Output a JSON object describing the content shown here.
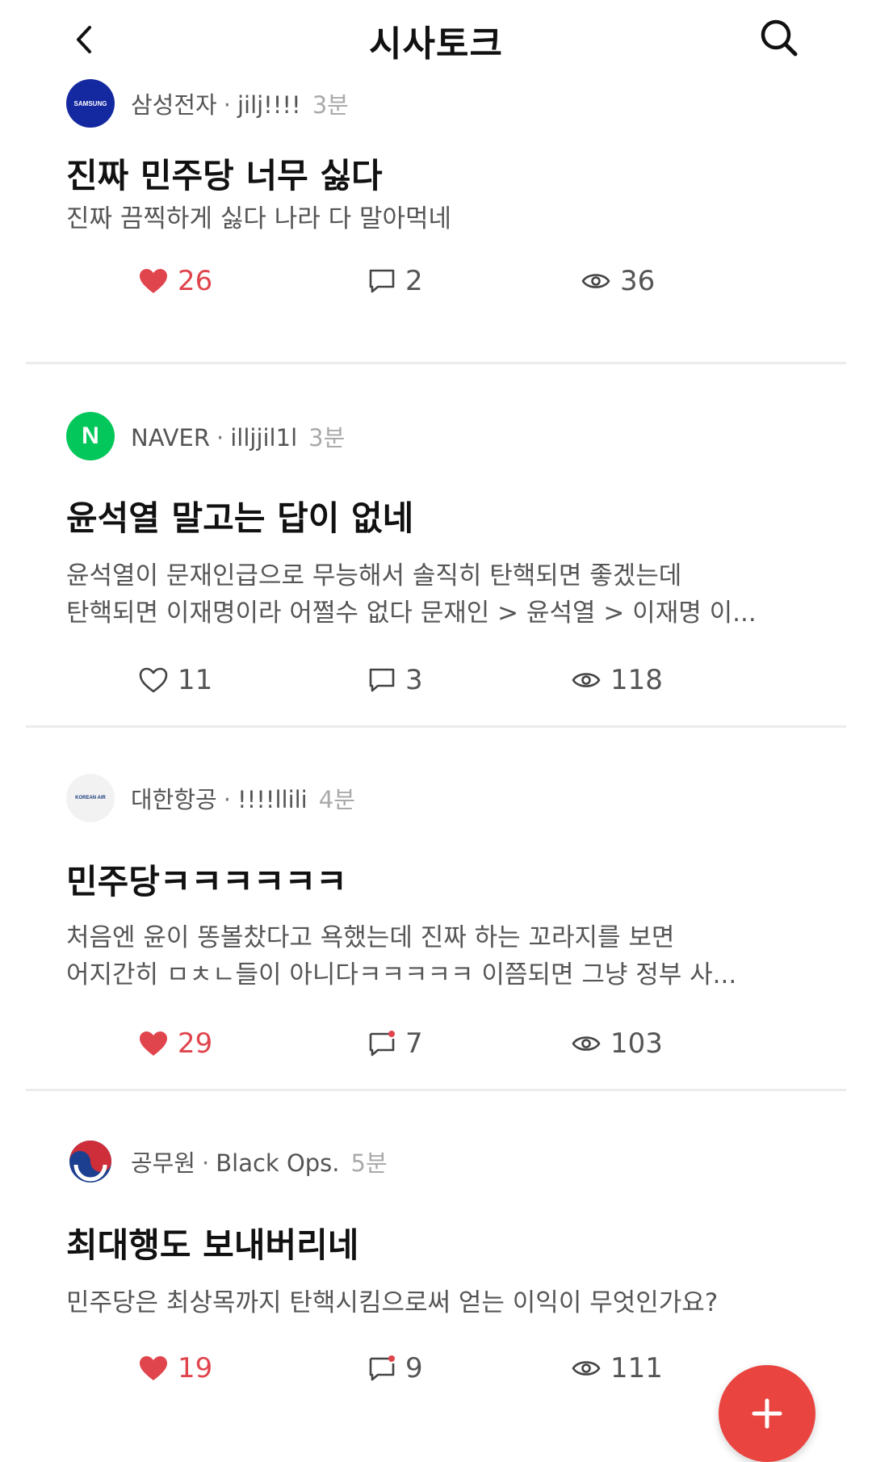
{
  "header": {
    "title": "시사토크",
    "back_icon": "chevron-left-icon",
    "search_icon": "search-icon"
  },
  "posts": [
    {
      "company": "삼성전자",
      "author": "jilj!!!!",
      "time": "3분",
      "logo_icon": "samsung-logo",
      "logo_text": "SAMSUNG",
      "title": "진짜 민주당 너무 싫다",
      "body": [
        "진짜 끔찍하게 싫다 나라 다 말아먹네"
      ],
      "likes": "26",
      "liked": true,
      "comments": "2",
      "views": "36"
    },
    {
      "company": "NAVER",
      "author": "illjjil1l",
      "time": "3분",
      "logo_icon": "naver-logo",
      "logo_text": "N",
      "title": "윤석열 말고는 답이 없네",
      "body": [
        "윤석열이 문재인급으로 무능해서 솔직히 탄핵되면 좋겠는데",
        "탄핵되면 이재명이라 어쩔수 없다  문재인 > 윤석열 > 이재명 이..."
      ],
      "likes": "11",
      "liked": false,
      "comments": "3",
      "views": "118"
    },
    {
      "company": "대한항공",
      "author": "!!!!llili",
      "time": "4분",
      "logo_icon": "korean-air-logo",
      "logo_text": "KOREAN AIR",
      "title": "민주당ㅋㅋㅋㅋㅋㅋ",
      "body": [
        "처음엔 윤이 똥볼찼다고 욕했는데 진짜 하는 꼬라지를 보면",
        "어지간히 ㅁㅊㄴ들이 아니다ㅋㅋㅋㅋㅋ  이쯤되면 그냥 정부 사..."
      ],
      "likes": "29",
      "liked": true,
      "comments": "7",
      "views": "103"
    },
    {
      "company": "공무원",
      "author": "Black Ops.",
      "time": "5분",
      "logo_icon": "korea-government-logo",
      "logo_text": "",
      "title": "최대행도 보내버리네",
      "body": [
        "민주당은 최상목까지 탄핵시킴으로써 얻는 이익이 무엇인가요?"
      ],
      "likes": "19",
      "liked": true,
      "comments": "9",
      "views": "111"
    }
  ],
  "icons": {
    "like": "heart-icon",
    "comment": "comment-icon",
    "view": "eye-icon",
    "fab": "plus-icon"
  },
  "colors": {
    "accent": "#e94440",
    "like_active": "#e0454d",
    "naver_green": "#03c75a",
    "samsung_blue": "#1428a0"
  }
}
